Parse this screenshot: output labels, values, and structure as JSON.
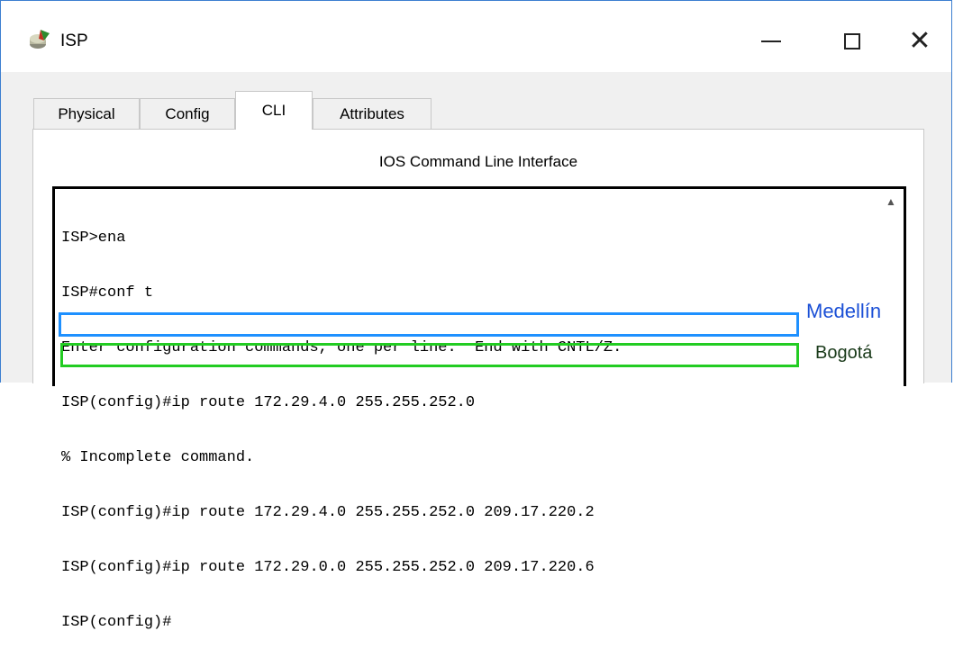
{
  "window": {
    "title": "ISP",
    "app_icon": "router-icon",
    "controls": {
      "minimize": "—",
      "maximize": "☐",
      "close": "✕"
    }
  },
  "tabs": [
    {
      "label": "Physical",
      "active": false
    },
    {
      "label": "Config",
      "active": false
    },
    {
      "label": "CLI",
      "active": true
    },
    {
      "label": "Attributes",
      "active": false
    }
  ],
  "panel": {
    "title": "IOS Command Line Interface"
  },
  "terminal": {
    "lines": [
      "ISP>ena",
      "ISP#conf t",
      "Enter configuration commands, one per line.  End with CNTL/Z.",
      "ISP(config)#ip route 172.29.4.0 255.255.252.0",
      "% Incomplete command.",
      "ISP(config)#ip route 172.29.4.0 255.255.252.0 209.17.220.2",
      "ISP(config)#ip route 172.29.0.0 255.255.252.0 209.17.220.6",
      "ISP(config)#"
    ]
  },
  "annotations": {
    "medellin": {
      "text": "Medellín",
      "color": "#1a4fd6",
      "box_color": "#1e90ff"
    },
    "bogota": {
      "text": "Bogotá",
      "color": "#1a3a1a",
      "box_color": "#22cc22"
    }
  }
}
